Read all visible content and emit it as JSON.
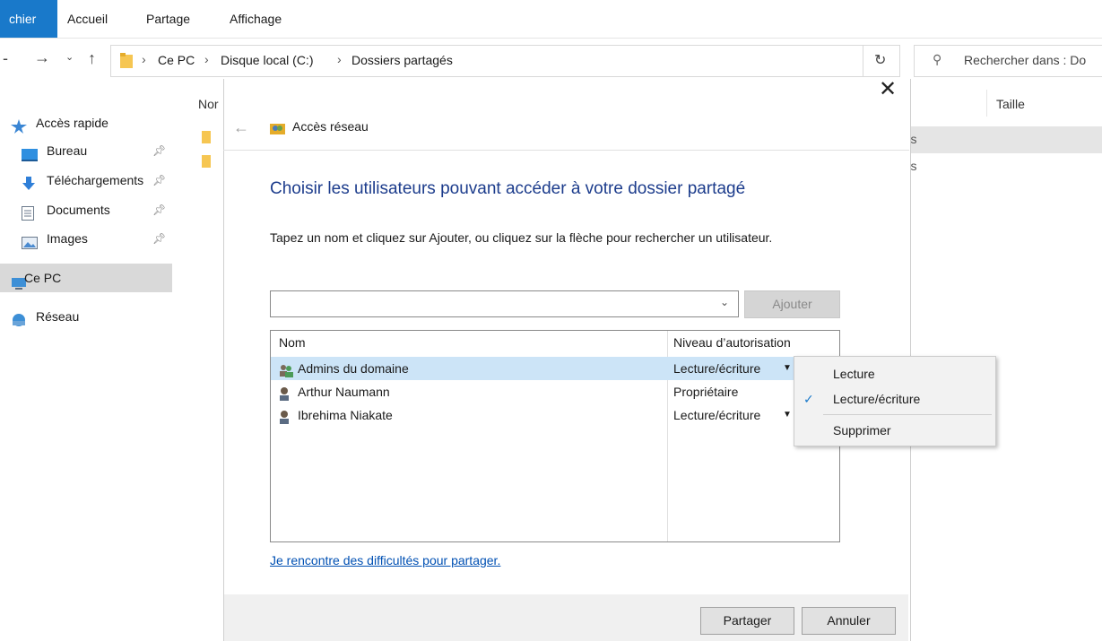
{
  "ribbon": {
    "tabs": [
      "chier",
      "Accueil",
      "Partage",
      "Affichage"
    ]
  },
  "address": {
    "crumbs": [
      "Ce PC",
      "Disque local (C:)",
      "Dossiers partagés"
    ],
    "search_placeholder": "Rechercher dans : Do"
  },
  "sidebar": {
    "items": [
      {
        "label": "Accès rapide",
        "icon": "star-icon"
      },
      {
        "label": "Bureau",
        "icon": "desktop-icon",
        "pinned": true
      },
      {
        "label": "Téléchargements",
        "icon": "download-icon",
        "pinned": true
      },
      {
        "label": "Documents",
        "icon": "documents-icon",
        "pinned": true
      },
      {
        "label": "Images",
        "icon": "images-icon",
        "pinned": true
      },
      {
        "label": "Ce PC",
        "icon": "computer-icon",
        "selected": true
      },
      {
        "label": "Réseau",
        "icon": "network-icon"
      }
    ]
  },
  "background_list": {
    "header_name": "Nor",
    "header_size": "Taille",
    "row_type_fragments": [
      "iers",
      "iers"
    ]
  },
  "dialog": {
    "title": "Accès réseau",
    "heading": "Choisir les utilisateurs pouvant accéder à votre dossier partagé",
    "instructions": "Tapez un nom et cliquez sur Ajouter, ou cliquez sur la flèche pour rechercher un utilisateur.",
    "input_value": "",
    "add_button": "Ajouter",
    "columns": {
      "name": "Nom",
      "level": "Niveau d’autorisation"
    },
    "users": [
      {
        "name": "Admins du domaine",
        "level": "Lecture/écriture",
        "has_dropdown": true,
        "selected": true,
        "icon": "group-icon"
      },
      {
        "name": "Arthur Naumann",
        "level": "Propriétaire",
        "has_dropdown": false,
        "selected": false,
        "icon": "user-icon"
      },
      {
        "name": "Ibrehima Niakate",
        "level": "Lecture/écriture",
        "has_dropdown": true,
        "selected": false,
        "icon": "user-icon"
      }
    ],
    "help_link": "Je rencontre des difficultés pour partager.",
    "share_button": "Partager",
    "cancel_button": "Annuler"
  },
  "context_menu": {
    "items": [
      {
        "label": "Lecture",
        "checked": false
      },
      {
        "label": "Lecture/écriture",
        "checked": true
      },
      {
        "label": "Supprimer",
        "checked": false
      }
    ]
  },
  "colors": {
    "accent": "#1979ca",
    "heading": "#1c3c8c",
    "selection": "#cce4f7",
    "link": "#0050b3"
  }
}
